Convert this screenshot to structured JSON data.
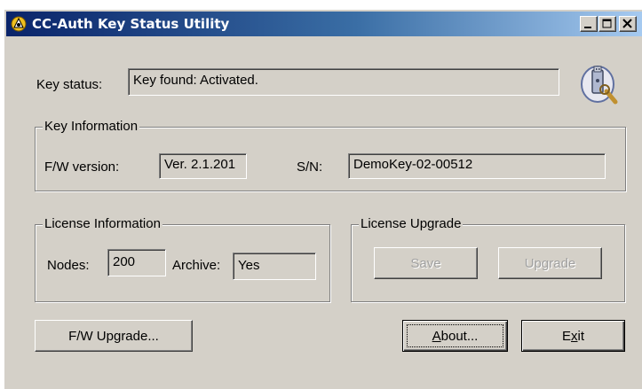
{
  "window": {
    "title": "CC-Auth Key Status Utility",
    "icon": "app-shield-icon",
    "controls": {
      "minimize": "minimize-icon",
      "maximize": "maximize-icon",
      "close": "close-icon"
    }
  },
  "key_status": {
    "label": "Key status:",
    "value": "Key found: Activated.",
    "icon": "usb-key-search-icon"
  },
  "key_information": {
    "title": "Key Information",
    "fw_version_label": "F/W version:",
    "fw_version_value": "Ver. 2.1.201",
    "sn_label": "S/N:",
    "sn_value": "DemoKey-02-00512"
  },
  "license_information": {
    "title": "License Information",
    "nodes_label": "Nodes:",
    "nodes_value": "200",
    "archive_label": "Archive:",
    "archive_value": "Yes"
  },
  "license_upgrade": {
    "title": "License Upgrade",
    "save_label": "Save",
    "upgrade_label": "Upgrade"
  },
  "buttons": {
    "fw_upgrade_label": "F/W Upgrade...",
    "about_mnemonic": "A",
    "about_rest": "bout...",
    "exit_pre": "E",
    "exit_mnemonic": "x",
    "exit_rest": "it"
  },
  "colors": {
    "face": "#d4d0c8",
    "title_start": "#0a246a",
    "title_end": "#a6caf0",
    "disabled_text": "#a0a0a0"
  }
}
